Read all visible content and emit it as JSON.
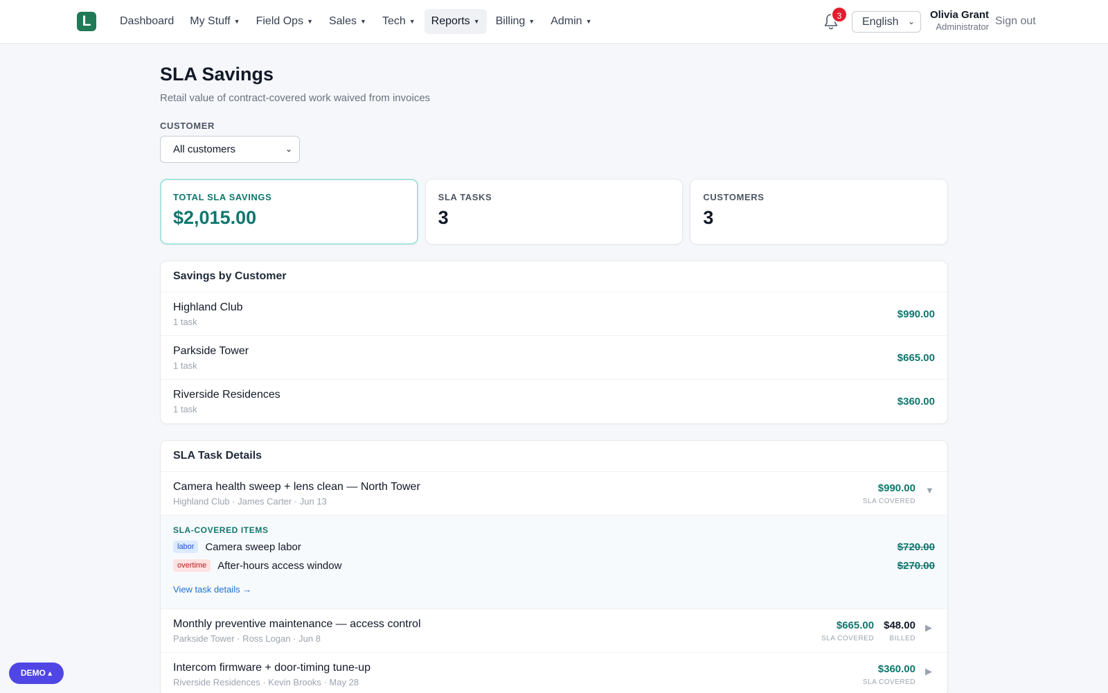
{
  "header": {
    "logo_letter": "L",
    "nav": [
      {
        "label": "Dashboard",
        "has_caret": false
      },
      {
        "label": "My Stuff",
        "has_caret": true
      },
      {
        "label": "Field Ops",
        "has_caret": true
      },
      {
        "label": "Sales",
        "has_caret": true
      },
      {
        "label": "Tech",
        "has_caret": true
      },
      {
        "label": "Reports",
        "has_caret": true,
        "active": true
      },
      {
        "label": "Billing",
        "has_caret": true
      },
      {
        "label": "Admin",
        "has_caret": true
      }
    ],
    "notifications_count": "3",
    "language": "English",
    "user_name": "Olivia Grant",
    "user_role": "Administrator",
    "sign_out": "Sign out"
  },
  "page": {
    "title": "SLA Savings",
    "subtitle": "Retail value of contract-covered work waived from invoices",
    "filter_label": "CUSTOMER",
    "filter_value": "All customers"
  },
  "stats": {
    "total_label": "TOTAL SLA SAVINGS",
    "total_value": "$2,015.00",
    "tasks_label": "SLA TASKS",
    "tasks_value": "3",
    "customers_label": "CUSTOMERS",
    "customers_value": "3"
  },
  "by_customer": {
    "title": "Savings by Customer",
    "rows": [
      {
        "name": "Highland Club",
        "sub": "1 task",
        "amount": "$990.00"
      },
      {
        "name": "Parkside Tower",
        "sub": "1 task",
        "amount": "$665.00"
      },
      {
        "name": "Riverside Residences",
        "sub": "1 task",
        "amount": "$360.00"
      }
    ]
  },
  "task_details": {
    "title": "SLA Task Details",
    "tasks": [
      {
        "name": "Camera health sweep + lens clean — North Tower",
        "meta": "Highland Club · James Carter · Jun 13",
        "covered": "$990.00",
        "covered_caption": "SLA COVERED",
        "toggle": "▼"
      },
      {
        "name": "Monthly preventive maintenance — access control",
        "meta": "Parkside Tower · Ross Logan · Jun 8",
        "covered": "$665.00",
        "covered_caption": "SLA COVERED",
        "billed": "$48.00",
        "billed_caption": "BILLED",
        "toggle": "▶"
      },
      {
        "name": "Intercom firmware + door-timing tune-up",
        "meta": "Riverside Residences · Kevin Brooks · May 28",
        "covered": "$360.00",
        "covered_caption": "SLA COVERED",
        "toggle": "▶"
      }
    ],
    "expanded": {
      "title": "SLA-COVERED ITEMS",
      "items": [
        {
          "tag": "labor",
          "label": "Camera sweep labor",
          "amount": "$720.00"
        },
        {
          "tag": "overtime",
          "label": "After-hours access window",
          "amount": "$270.00"
        }
      ],
      "link": "View task details →"
    }
  },
  "demo_button": "DEMO ▴",
  "colors": {
    "accent_green": "#0f766e",
    "logo_green": "#1f7a55",
    "badge_red": "#e11d2e",
    "demo_purple": "#4f46e5"
  }
}
